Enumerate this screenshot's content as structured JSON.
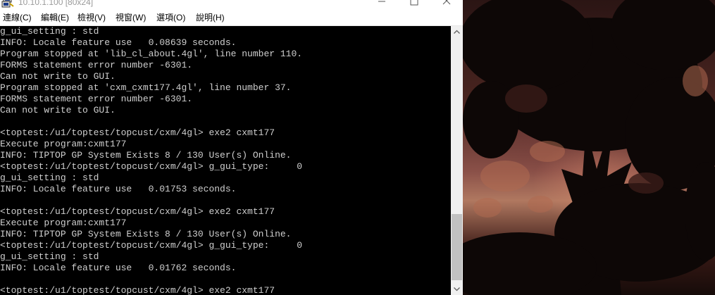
{
  "window": {
    "title": "10.10.1.100 [80x24]",
    "icon": "putty-icon",
    "controls": {
      "minimize": "minimize-icon",
      "maximize": "maximize-icon",
      "close": "close-icon"
    }
  },
  "menubar": {
    "items": [
      {
        "label": "連線(C)"
      },
      {
        "label": "編輯(E)"
      },
      {
        "label": "檢視(V)"
      },
      {
        "label": "視窗(W)"
      },
      {
        "label": "選項(O)"
      },
      {
        "label": "說明(H)"
      }
    ]
  },
  "console": {
    "lines": [
      "g_ui_setting : std",
      "INFO: Locale feature use   0.08639 seconds.",
      "Program stopped at 'lib_cl_about.4gl', line number 110.",
      "FORMS statement error number -6301.",
      "Can not write to GUI.",
      "Program stopped at 'cxm_cxmt177.4gl', line number 37.",
      "FORMS statement error number -6301.",
      "Can not write to GUI.",
      "",
      "<toptest:/u1/toptest/topcust/cxm/4gl> exe2 cxmt177",
      "Execute program:cxmt177",
      "INFO: TIPTOP GP System Exists 8 / 130 User(s) Online.",
      "<toptest:/u1/toptest/topcust/cxm/4gl> g_gui_type:     0",
      "g_ui_setting : std",
      "INFO: Locale feature use   0.01753 seconds.",
      "",
      "<toptest:/u1/toptest/topcust/cxm/4gl> exe2 cxmt177",
      "Execute program:cxmt177",
      "INFO: TIPTOP GP System Exists 8 / 130 User(s) Online.",
      "<toptest:/u1/toptest/topcust/cxm/4gl> g_gui_type:     0",
      "g_ui_setting : std",
      "INFO: Locale feature use   0.01762 seconds.",
      "",
      "<toptest:/u1/toptest/topcust/cxm/4gl> exe2 cxmt177"
    ],
    "colors": {
      "background": "#000000",
      "foreground": "#cfcfcf"
    }
  },
  "scrollbar": {
    "position": 0.86
  }
}
